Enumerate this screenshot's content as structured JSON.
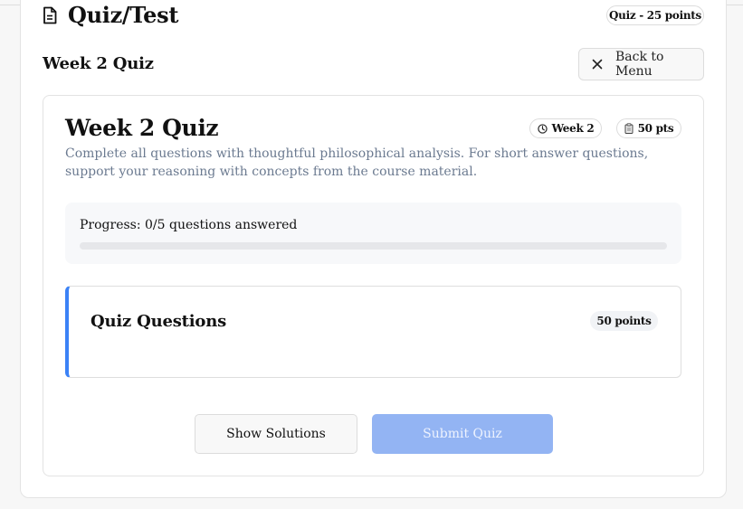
{
  "header": {
    "title": "Quiz/Test",
    "icon": "document-icon",
    "points_label": "Quiz - 25 points"
  },
  "section": {
    "title": "Week 2 Quiz",
    "back_label": "Back to Menu",
    "back_icon": "close-icon"
  },
  "quiz": {
    "title": "Week 2 Quiz",
    "week_badge": "Week 2",
    "week_icon": "clock-icon",
    "points_badge": "50 pts",
    "points_icon": "clipboard-icon",
    "description": "Complete all questions with thoughtful philosophical analysis. For short answer questions, support your reasoning with concepts from the course material."
  },
  "progress": {
    "label": "Progress: 0/5 questions answered",
    "answered": 0,
    "total": 5
  },
  "questions": {
    "title": "Quiz Questions",
    "points": "50 points"
  },
  "actions": {
    "show_solutions": "Show Solutions",
    "submit": "Submit Quiz"
  },
  "colors": {
    "accent": "#3b82f6",
    "submit_disabled": "#93b4f3",
    "muted_text": "#6b7a90"
  }
}
